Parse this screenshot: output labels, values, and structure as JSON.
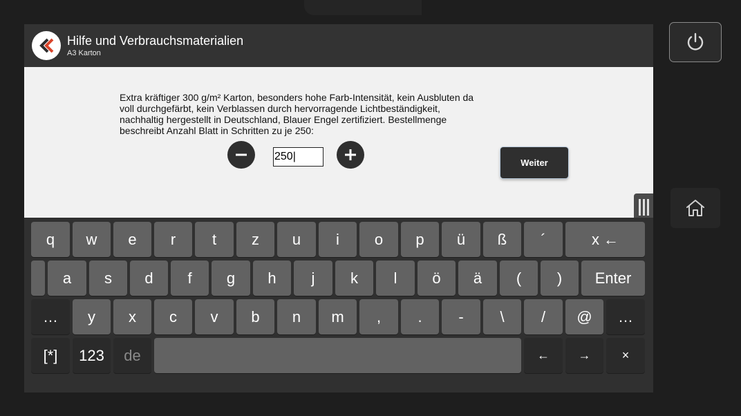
{
  "header": {
    "title": "Hilfe und Verbrauchsmaterialien",
    "subtitle": "A3 Karton"
  },
  "content": {
    "description": "Extra kräftiger 300 g/m² Karton, besonders hohe Farb-Intensität, kein Ausbluten da voll durchgefärbt, kein Verblassen durch hervorragende Lichtbeständigkeit, nachhaltig hergestellt in Deutschland, Blauer Engel zertifiziert. Bestellmenge beschreibt Anzahl Blatt in Schritten zu je 250:",
    "quantity_value": "250|",
    "weiter_label": "Weiter"
  },
  "icons": {
    "back": "back-chevron-icon",
    "minus": "minus-circle-icon",
    "plus": "plus-circle-icon",
    "power": "power-icon",
    "home": "home-icon",
    "handle": "drag-handle-icon"
  },
  "colors": {
    "accent_red": "#d9452b",
    "key": "#626262",
    "key_dark": "#2a2a2a",
    "panel": "#f1f1f1"
  },
  "keyboard": {
    "row1": [
      "q",
      "w",
      "e",
      "r",
      "t",
      "z",
      "u",
      "i",
      "o",
      "p",
      "ü",
      "ß",
      "´",
      "x ←"
    ],
    "row2": [
      "a",
      "s",
      "d",
      "f",
      "g",
      "h",
      "j",
      "k",
      "l",
      "ö",
      "ä",
      "(",
      ")",
      "Enter"
    ],
    "row3": [
      "…",
      "y",
      "x",
      "c",
      "v",
      "b",
      "n",
      "m",
      ",",
      ".",
      "-",
      "\\",
      "/",
      "@",
      "…"
    ],
    "row4": [
      "[*]",
      "123",
      "de",
      "←",
      "→",
      "×"
    ]
  }
}
